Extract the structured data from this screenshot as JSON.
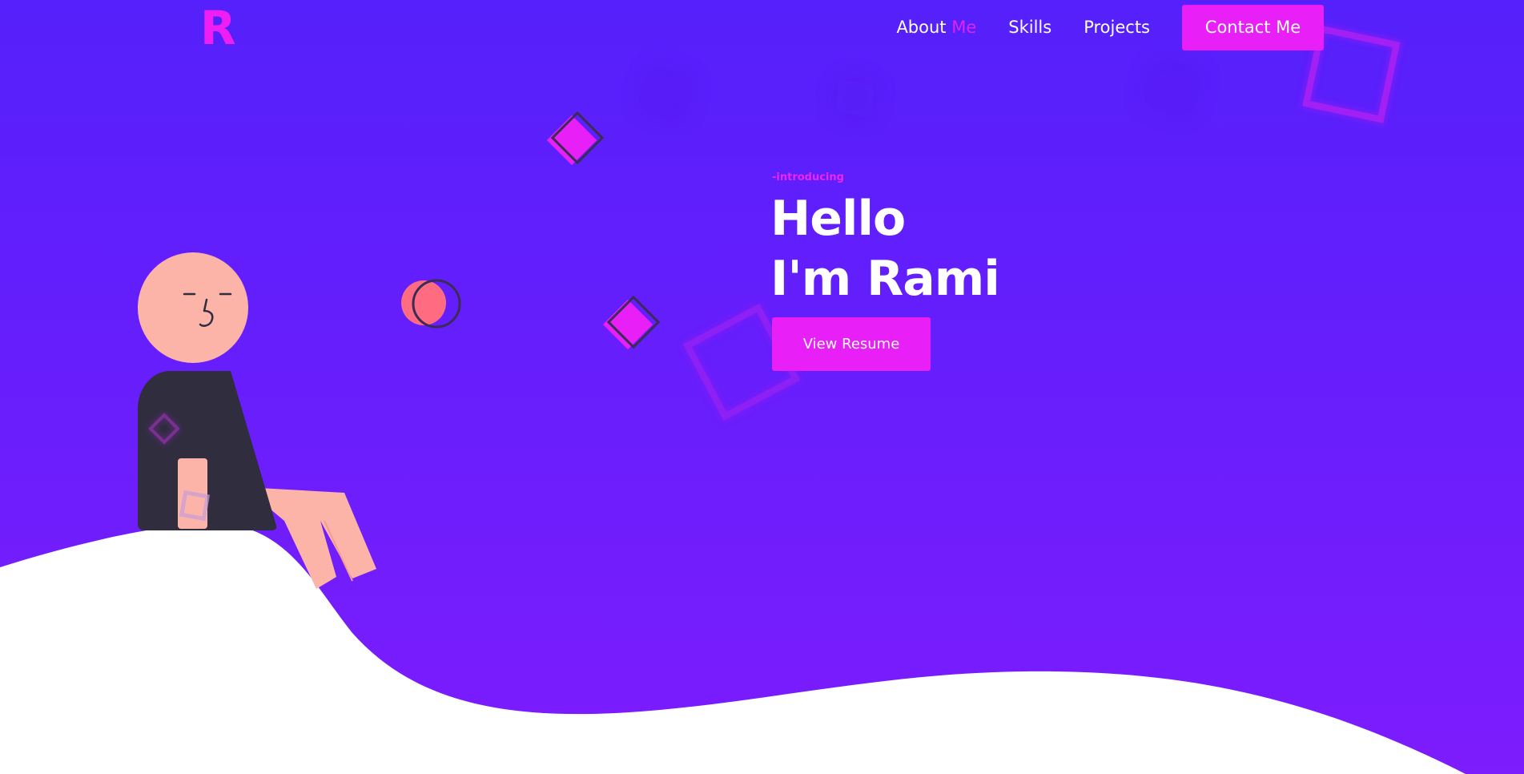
{
  "brand": {
    "logo_letter": "R"
  },
  "nav": {
    "about_label": "About",
    "about_accent": "Me",
    "skills_label": "Skills",
    "projects_label": "Projects",
    "contact_label": "Contact Me"
  },
  "hero": {
    "intro": "-introducing",
    "title_line1": "Hello",
    "title_line2": "I'm Rami",
    "resume_label": "View Resume"
  },
  "colors": {
    "background_top": "#5520fb",
    "background_bottom": "#7d1cfd",
    "accent_pink": "#e81ff6",
    "text_white": "#ffffff",
    "skin": "#fdb4a8",
    "shirt": "#302d3f",
    "coral_circle": "#ff6b81"
  }
}
